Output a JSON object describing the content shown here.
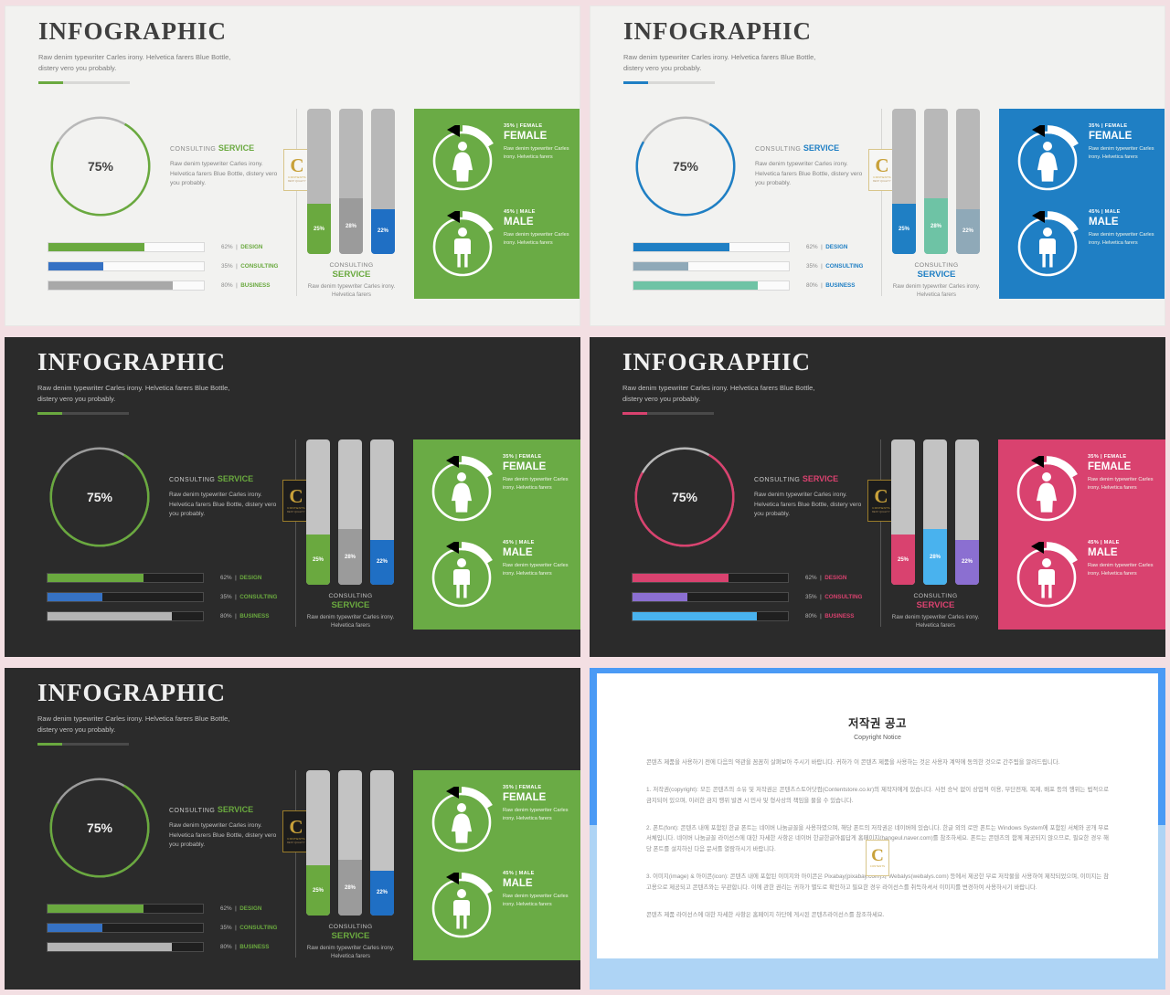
{
  "theme_colors": {
    "page_bg": "#f3dfe3",
    "light_panel_bg": "#f2f2f0",
    "dark_panel_bg": "#2b2b2b",
    "green": "#6aa93f",
    "green_panel": "#6aab45",
    "blue": "#1f7fc4",
    "blue_panel": "#1f7fc4",
    "gray": "#9b9b9b",
    "teal": "#6ec3a5",
    "slate": "#8fa9b8",
    "pink": "#d9426f",
    "pink_panel": "#d9426f",
    "purple": "#8b6fd1",
    "skyblue": "#49b2ee",
    "gold": "#c8a13a",
    "frame_blue": "#4a9af5",
    "frame_blue_light": "#aed4f5"
  },
  "slide": {
    "title": "INFOGRAPHIC",
    "subtitle": "Raw denim typewriter Carles irony. Helvetica farers Blue Bottle, distery vero you probably.",
    "donut": {
      "value_label": "75%",
      "percent": 75
    },
    "service": {
      "eyebrow_light": "CONSULTING",
      "eyebrow_strong": "SERVICE",
      "body": "Raw denim typewriter Carles irony. Helvetica farers Blue Bottle, distery vero you probably."
    },
    "badge": {
      "letter": "C",
      "word1": "CONTENTS",
      "word2": "BEST QUALITY"
    },
    "progress_bars": [
      {
        "label": "DESIGN",
        "percent_label": "62%",
        "percent": 62
      },
      {
        "label": "CONSULTING",
        "percent_label": "35%",
        "percent": 35
      },
      {
        "label": "BUSINESS",
        "percent_label": "80%",
        "percent": 80
      }
    ],
    "vertical_bars": [
      {
        "value_label": "25%",
        "percent": 25
      },
      {
        "value_label": "28%",
        "percent": 28
      },
      {
        "value_label": "22%",
        "percent": 22
      }
    ],
    "vertical_caption": {
      "line1": "CONSULTING",
      "line2": "SERVICE",
      "line3": "Raw denim typewriter Carles irony. Helvetica farers"
    },
    "gender": [
      {
        "pct_label": "35%  |  FEMALE",
        "name": "FEMALE",
        "body": "Raw denim typewriter Carles irony. Helvetica farers",
        "icon": "female-icon",
        "percent": 35
      },
      {
        "pct_label": "45%  |  MALE",
        "name": "MALE",
        "body": "Raw denim typewriter Carles irony. Helvetica farers",
        "icon": "male-icon",
        "percent": 45
      }
    ]
  },
  "palettes": [
    {
      "accent": "#6aa93f",
      "bar1": "#6aa93f",
      "bar2": "#3672c4",
      "bar3": "#a8a8a8",
      "v1": "#6aa93f",
      "v2": "#9b9b9b",
      "v3": "#1f6fc4",
      "panel": "#6aab45",
      "ring_rest": "#b8b8b8",
      "label": "#6aa93f",
      "service": "#6aa93f"
    },
    {
      "accent": "#1f7fc4",
      "bar1": "#1f7fc4",
      "bar2": "#8fa9b8",
      "bar3": "#6ec3a5",
      "v1": "#1f7fc4",
      "v2": "#6ec3a5",
      "v3": "#8fa9b8",
      "panel": "#1f7fc4",
      "ring_rest": "#b8b8b8",
      "label": "#1f7fc4",
      "service": "#1f7fc4"
    },
    {
      "accent": "#6aa93f",
      "bar1": "#6aa93f",
      "bar2": "#3672c4",
      "bar3": "#b4b4b4",
      "v1": "#6aa93f",
      "v2": "#9b9b9b",
      "v3": "#1f6fc4",
      "panel": "#6aab45",
      "ring_rest": "#9b9b9b",
      "label": "#6aa93f",
      "service": "#6aa93f"
    },
    {
      "accent": "#d9426f",
      "bar1": "#d9426f",
      "bar2": "#8b6fd1",
      "bar3": "#49b2ee",
      "v1": "#d9426f",
      "v2": "#49b2ee",
      "v3": "#8b6fd1",
      "panel": "#d9426f",
      "ring_rest": "#b8b8b8",
      "label": "#d9426f",
      "service": "#d9426f"
    },
    {
      "accent": "#6aa93f",
      "bar1": "#6aa93f",
      "bar2": "#3672c4",
      "bar3": "#b4b4b4",
      "v1": "#6aa93f",
      "v2": "#9b9b9b",
      "v3": "#1f6fc4",
      "panel": "#6aab45",
      "ring_rest": "#9b9b9b",
      "label": "#6aa93f",
      "service": "#6aa93f"
    }
  ],
  "copyright": {
    "title": "저작권 공고",
    "subtitle": "Copyright Notice",
    "intro": "콘텐츠 제품을 사용하기 전에 다음의 약관을 꼼꼼히 살펴보아 주시기 바랍니다. 귀하가 이 콘텐츠 제품을 사용하는 것은 사용자 계약에 동의한 것으로 간주됨을 알려드립니다.",
    "item1": "1. 저작권(copyright): 모든 콘텐츠의 소유 및 저작권은 콘텐츠스토어닷컴(Contentstore.co.kr)의 제작자에게 있습니다. 사전 승낙 없이 상업적 이용, 무단전재, 복제, 배포 등의 행위는 법적으로 금지되어 있으며, 이러한 금지 행위 발견 시 민사 및 형사상의 책임을 물을 수 있습니다.",
    "item2": "2. 폰트(font): 콘텐츠 내에 포함된 한글 폰트는 네이버 나눔글꼴을 사용하였으며, 해당 폰트의 저작권은 네이버에 있습니다. 한글 외의 로만 폰트는 Windows System에 포함된 서체와 공개 무료 서체입니다. 네이버 나눔글꼴 라이선스에 대한 자세한 사항은 네이버 한글한글아름답게 홈페이지(hangeul.naver.com)를 참조하세요. 폰트는 콘텐츠의 함께 제공되지 않으므로, 필요한 경우 해당 폰트를 설치하신 다음 문서를 열람하시기 바랍니다.",
    "item3": "3. 이미지(image) & 아이콘(icon): 콘텐츠 내에 포함된 이미지와 아이콘은 Pixabay(pixabay.com)와 Webalys(webalys.com) 등에서 제공한 무료 저작물을 사용하여 제작되었으며, 이미지는 참고용으로 제공되고 콘텐츠와는 무관합니다. 이에 관한 권리는 귀하가 별도로 확인하고 필요한 경우 라이선스를 취득하셔서 이미지를 변경하여 사용하시기 바랍니다.",
    "footer": "콘텐츠 제품 라이선스에 대한 자세한 사항은 홈페이지 하단에 게시된 콘텐츠라이선스를 참조하세요.",
    "badge": {
      "letter": "C",
      "word1": "CONTENTS"
    }
  }
}
